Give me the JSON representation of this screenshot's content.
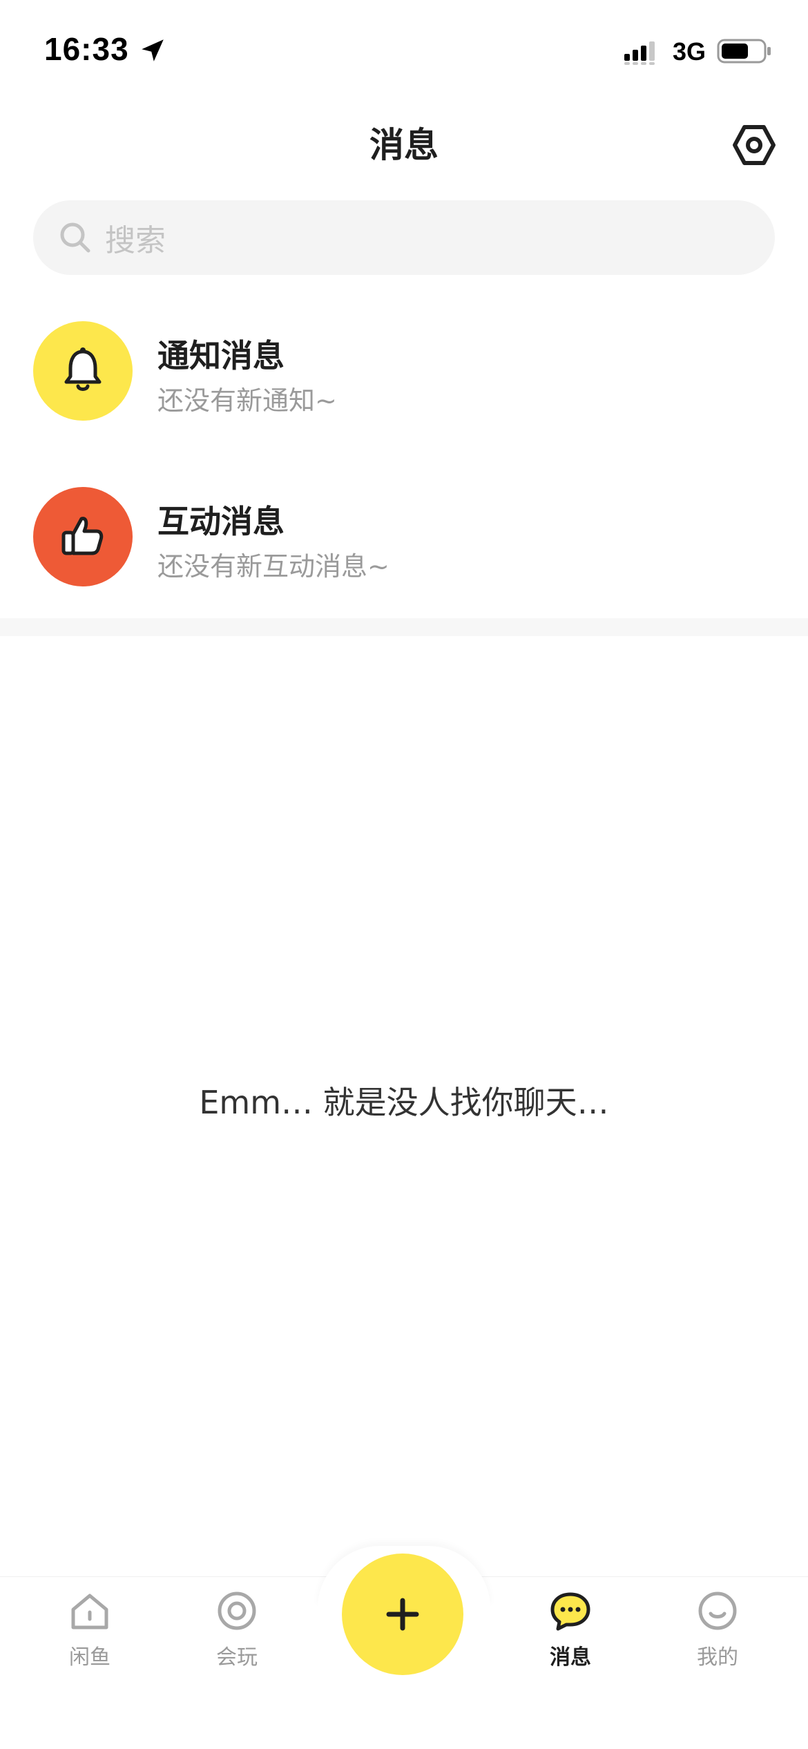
{
  "status_bar": {
    "time": "16:33",
    "network": "3G"
  },
  "header": {
    "title": "消息",
    "settings_icon": "settings-hex-icon"
  },
  "search": {
    "placeholder": "搜索"
  },
  "messages": [
    {
      "title": "通知消息",
      "subtitle": "还没有新通知~",
      "icon": "bell-icon",
      "color": "#FDE74C"
    },
    {
      "title": "互动消息",
      "subtitle": "还没有新互动消息~",
      "icon": "thumbs-up-icon",
      "color": "#EE5A36"
    }
  ],
  "empty_state": {
    "text": "Emm… 就是没人找你聊天…"
  },
  "tab_bar": {
    "items": [
      {
        "label": "闲鱼",
        "icon": "home-icon",
        "active": false
      },
      {
        "label": "会玩",
        "icon": "circle-icon",
        "active": false
      },
      {
        "label": "消息",
        "icon": "chat-bubble-icon",
        "active": true
      },
      {
        "label": "我的",
        "icon": "smiley-icon",
        "active": false
      }
    ],
    "publish_icon": "plus-icon"
  },
  "colors": {
    "accent": "#FDE74C",
    "interaction": "#EE5A36",
    "muted_text": "#9A9A9A",
    "search_bg": "#F4F4F4"
  }
}
